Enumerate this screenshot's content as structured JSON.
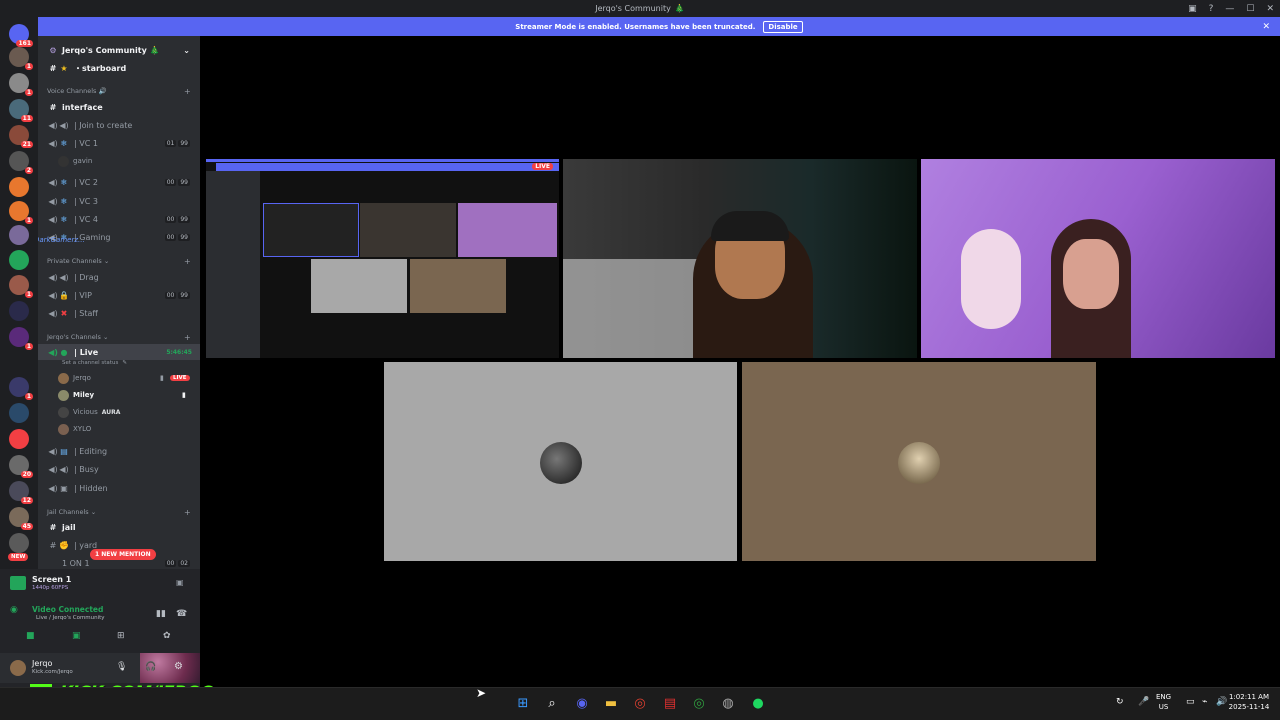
{
  "window": {
    "title": "Jerqo's Community",
    "emoji": "🎄"
  },
  "banner": {
    "text": "Streamer Mode is enabled. Usernames have been truncated.",
    "button": "Disable"
  },
  "servers": {
    "dm_badge": "161",
    "badges": [
      "1",
      "1",
      "1",
      "1",
      "11",
      "21",
      "2",
      "1",
      "1",
      "2",
      "1",
      "1",
      "2",
      "20",
      "12",
      "45"
    ]
  },
  "server_header": {
    "name": "Jerqo's Community",
    "emoji": "🎄"
  },
  "channels": {
    "starboard": "・starboard",
    "voice_category": "Voice Channels",
    "interface": "interface",
    "join_to_create": "| Join to create",
    "vc1": "| VC 1",
    "vc1_user": "gavin",
    "vc1_count": [
      "01",
      "99"
    ],
    "vc2": "| VC 2",
    "vc2_count": [
      "00",
      "99"
    ],
    "vc3": "| VC 3",
    "vc4": "| VC 4",
    "vc4_count": [
      "00",
      "99"
    ],
    "gaming": "| Gaming",
    "gaming_count": [
      "00",
      "99"
    ],
    "darkgamerz": "DarkGamerz...",
    "private_category": "Private Channels",
    "drag": "| Drag",
    "vip": "| VIP",
    "vip_count": [
      "00",
      "99"
    ],
    "staff": "| Staff",
    "jerqos_category": "Jerqo's Channels",
    "live": "| Live",
    "live_time": "5:46:45",
    "status_prompt": "Set a channel status",
    "users": [
      "Jerqo",
      "Miley",
      "Vicious",
      "XYLO"
    ],
    "aura": "AURA",
    "live_badge": "LIVE",
    "editing": "| Editing",
    "busy": "| Busy",
    "hidden": "| Hidden",
    "jail_category": "Jail Channels",
    "jail": "jail",
    "yard": "| yard",
    "one_on_one": "1 ON 1",
    "one_count": [
      "00",
      "02"
    ],
    "new_mention": "1 NEW MENTION",
    "new": "NEW"
  },
  "stream": {
    "name": "Screen 1",
    "quality": "1440p 60FPS"
  },
  "voice": {
    "status": "Video Connected",
    "location": "Live / Jerqo's Community"
  },
  "user": {
    "name": "Jerqo",
    "status": "Kick.com/Jerqo"
  },
  "overlay": {
    "kick_text": "KICK.COM/JERQO",
    "kick_logo": "K"
  },
  "tiles": {
    "screenshare_live": "LIVE"
  },
  "taskbar": {
    "lang_top": "ENG",
    "lang_bottom": "US",
    "time": "1:02:11 AM",
    "date": "2025-11-14"
  },
  "colors": {
    "blurple": "#5865f2",
    "green": "#23a55a",
    "red": "#f23f43",
    "kick_green": "#53fc18"
  }
}
